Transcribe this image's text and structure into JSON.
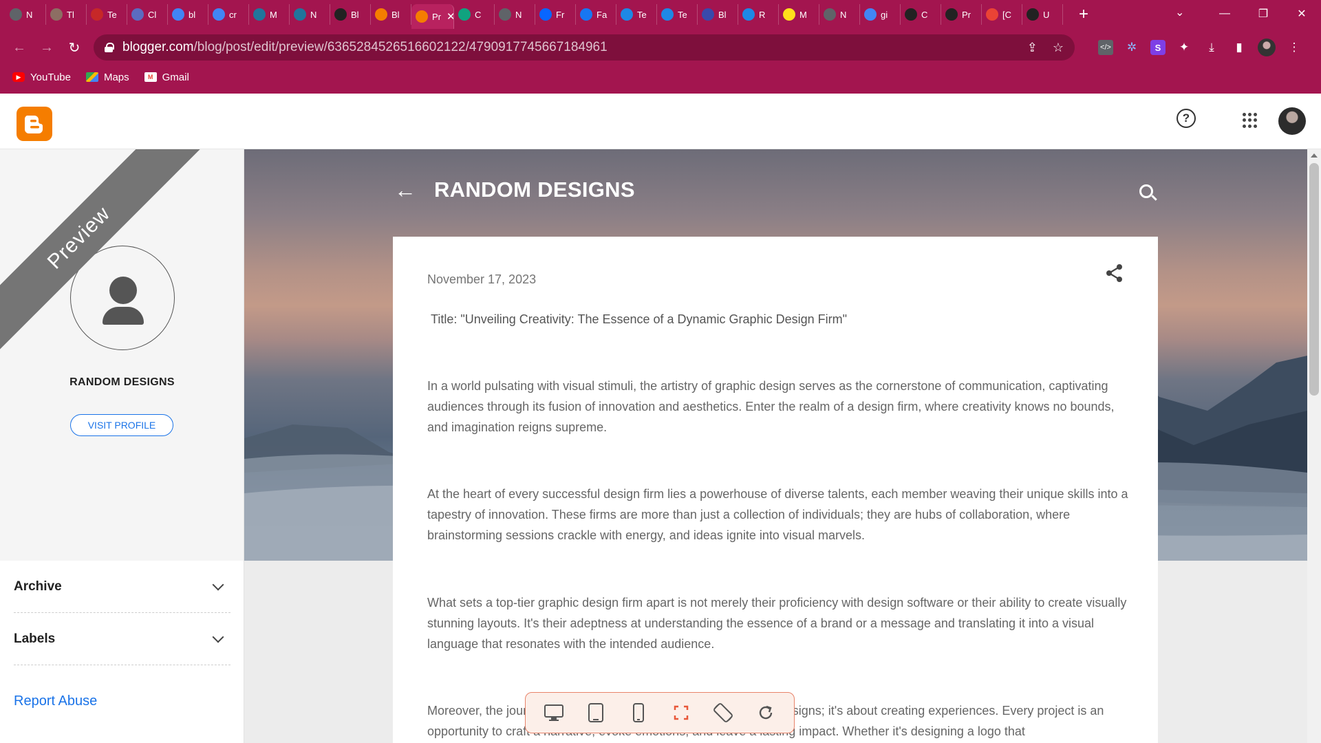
{
  "browser": {
    "tabs": [
      {
        "label": "N",
        "icon": "chatgpt-icon",
        "color": "#5f6368"
      },
      {
        "label": "Tl",
        "icon": "avatar-icon",
        "color": "#8d6e63"
      },
      {
        "label": "Te",
        "icon": "book-icon",
        "color": "#c62828"
      },
      {
        "label": "Cl",
        "icon": "bell-icon",
        "color": "#5c6bc0"
      },
      {
        "label": "bl",
        "icon": "google-icon",
        "color": "#4285f4"
      },
      {
        "label": "cr",
        "icon": "google-icon",
        "color": "#4285f4"
      },
      {
        "label": "M",
        "icon": "wordpress-icon",
        "color": "#21759b"
      },
      {
        "label": "N",
        "icon": "wordpress-icon",
        "color": "#21759b"
      },
      {
        "label": "Bl",
        "icon": "compass-icon",
        "color": "#222222"
      },
      {
        "label": "Bl",
        "icon": "blogger-icon",
        "color": "#f57d00"
      },
      {
        "label": "Pr",
        "icon": "blogger-icon",
        "color": "#f57d00",
        "active": true
      },
      {
        "label": "C",
        "icon": "chatgpt-icon",
        "color": "#10a37f"
      },
      {
        "label": "N",
        "icon": "chatgpt-icon",
        "color": "#5f6368"
      },
      {
        "label": "Fr",
        "icon": "meta-icon",
        "color": "#0866ff"
      },
      {
        "label": "Fa",
        "icon": "facebook-icon",
        "color": "#1877f2"
      },
      {
        "label": "Te",
        "icon": "c-icon",
        "color": "#1e88e5"
      },
      {
        "label": "Te",
        "icon": "c-icon",
        "color": "#1e88e5"
      },
      {
        "label": "Bl",
        "icon": "calendar-icon",
        "color": "#3949ab"
      },
      {
        "label": "R",
        "icon": "c-icon",
        "color": "#1e88e5"
      },
      {
        "label": "M",
        "icon": "mailchimp-icon",
        "color": "#ffe01b"
      },
      {
        "label": "N",
        "icon": "chatgpt-icon",
        "color": "#5f6368"
      },
      {
        "label": "gi",
        "icon": "google-icon",
        "color": "#4285f4"
      },
      {
        "label": "C",
        "icon": "github-icon",
        "color": "#222222"
      },
      {
        "label": "Pr",
        "icon": "github-icon",
        "color": "#222222"
      },
      {
        "label": "[C",
        "icon": "gmail-icon",
        "color": "#ea4335"
      },
      {
        "label": "U",
        "icon": "github-icon",
        "color": "#222222"
      }
    ],
    "close_tab_glyph": "✕",
    "new_tab_glyph": "+",
    "tab_search_glyph": "⌄",
    "window_controls": {
      "minimize": "—",
      "restore": "❐",
      "close": "✕"
    },
    "nav": {
      "back": "←",
      "forward": "→",
      "reload": "↻"
    },
    "url_host": "blogger.com",
    "url_path": "/blog/post/edit/preview/6365284526516602122/4790917745667184961",
    "omnibox_icons": {
      "share": "⇪",
      "star": "☆"
    },
    "extension_icons": {
      "devtools": "</>",
      "puzzle_alt": "✲",
      "stylus": "S",
      "extensions": "✦",
      "download": "⤓",
      "sidepanel": "▮",
      "menu": "⋮"
    },
    "bookmarks": [
      {
        "label": "YouTube",
        "icon": "youtube-icon",
        "glyph": "▶"
      },
      {
        "label": "Maps",
        "icon": "maps-icon",
        "glyph": ""
      },
      {
        "label": "Gmail",
        "icon": "gmail-icon",
        "glyph": "M"
      }
    ]
  },
  "blogger": {
    "logo": "B",
    "help_glyph": "?"
  },
  "sidebar": {
    "ribbon": "Preview",
    "blog_name": "RANDOM DESIGNS",
    "visit_profile": "VISIT PROFILE",
    "items": [
      {
        "label": "Archive"
      },
      {
        "label": "Labels"
      }
    ],
    "report_abuse": "Report Abuse"
  },
  "hero": {
    "back": "←",
    "title": "RANDOM DESIGNS"
  },
  "post": {
    "date": "November 17, 2023",
    "title": "Title: \"Unveiling Creativity: The Essence of a Dynamic Graphic Design Firm\"",
    "paragraphs": [
      "In a world pulsating with visual stimuli, the artistry of graphic design serves as the cornerstone of communication, captivating audiences through its fusion of innovation and aesthetics. Enter the realm of a design firm, where creativity knows no bounds, and imagination reigns supreme.",
      "At the heart of every successful design firm lies a powerhouse of diverse talents, each member weaving their unique skills into a tapestry of innovation. These firms are more than just a collection of individuals; they are hubs of collaboration, where brainstorming sessions crackle with energy, and ideas ignite into visual marvels.",
      "What sets a top-tier graphic design firm apart is not merely their proficiency with design software or their ability to create visually stunning layouts. It's their adeptness at understanding the essence of a brand or a message and translating it into a visual language that resonates with the intended audience.",
      "Moreover, the journey of a design firm isn't just about producing designs; it's about creating experiences. Every project is an opportunity to craft a narrative, evoke emotions, and leave a lasting impact. Whether it's designing a logo that"
    ]
  },
  "device_toolbar": [
    {
      "name": "desktop-view-icon"
    },
    {
      "name": "tablet-view-icon"
    },
    {
      "name": "mobile-view-icon"
    },
    {
      "name": "fullscreen-icon",
      "accent": "#e8583a"
    },
    {
      "name": "rotate-icon"
    },
    {
      "name": "refresh-icon"
    }
  ],
  "colors": {
    "browser_accent": "#a3154f",
    "link_blue": "#1a73e8",
    "blogger_orange": "#f57d00"
  }
}
